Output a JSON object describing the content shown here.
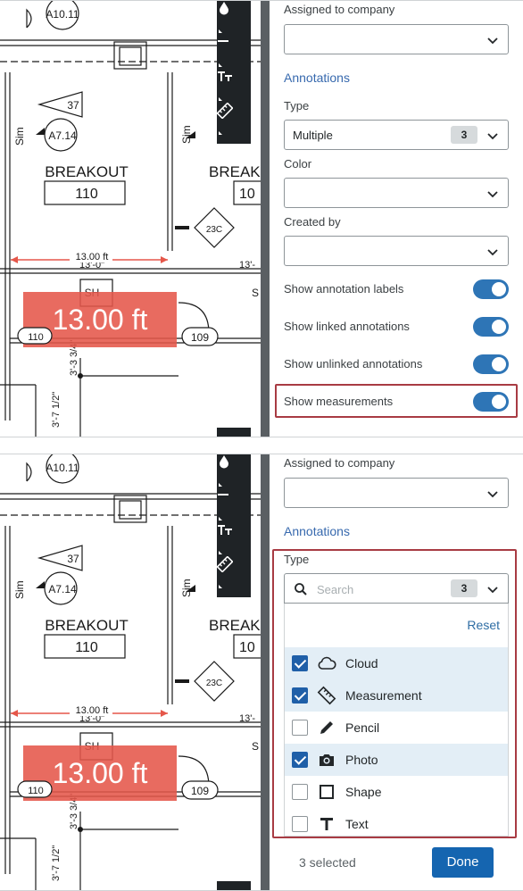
{
  "drawing": {
    "sheet_ref": "A10.11",
    "tag_37": "37",
    "tag_a714": "A7.14",
    "sim_label": "Sim",
    "room_name": "BREAKOUT",
    "room_number": "110",
    "room_name_2": "BREAK",
    "room_number_2": "10",
    "tag_23c": "23C",
    "measure_ft": "13.00 ft",
    "dim_13_0": "13'-0\"",
    "dim_13_right": "13'-",
    "sh_tag": "SH",
    "s_tag": "S",
    "measurement_big": "13.00 ft",
    "door_110": "110",
    "door_109": "109",
    "dim_33_4": "3'-3 3/4\"",
    "dim_7_12": "3'-7 1/2\""
  },
  "colors": {
    "accent": "#2e75b6",
    "highlight_border": "#a83b43",
    "measure_fill": "#e5574a",
    "toolbar": "#1f2326"
  },
  "toolbar": {
    "icons": [
      "drop-icon",
      "minus-icon",
      "text-size-icon",
      "ruler-icon"
    ]
  },
  "panel_top": {
    "assigned_company_label": "Assigned to company",
    "annotations_header": "Annotations",
    "type_label": "Type",
    "type_value": "Multiple",
    "type_count": "3",
    "color_label": "Color",
    "created_by_label": "Created by",
    "toggles": [
      {
        "label": "Show annotation labels",
        "on": true
      },
      {
        "label": "Show linked annotations",
        "on": true
      },
      {
        "label": "Show unlinked annotations",
        "on": true
      },
      {
        "label": "Show measurements",
        "on": true
      }
    ]
  },
  "panel_bottom": {
    "assigned_company_label": "Assigned to company",
    "annotations_header": "Annotations",
    "type_label": "Type",
    "search_placeholder": "Search",
    "type_count": "3",
    "reset_label": "Reset",
    "options": [
      {
        "label": "Cloud",
        "icon": "cloud-icon",
        "checked": true
      },
      {
        "label": "Measurement",
        "icon": "ruler-icon",
        "checked": true
      },
      {
        "label": "Pencil",
        "icon": "pencil-icon",
        "checked": false
      },
      {
        "label": "Photo",
        "icon": "camera-icon",
        "checked": true
      },
      {
        "label": "Shape",
        "icon": "square-icon",
        "checked": false
      },
      {
        "label": "Text",
        "icon": "text-icon",
        "checked": false
      }
    ],
    "selected_count": "3 selected",
    "done_label": "Done"
  }
}
